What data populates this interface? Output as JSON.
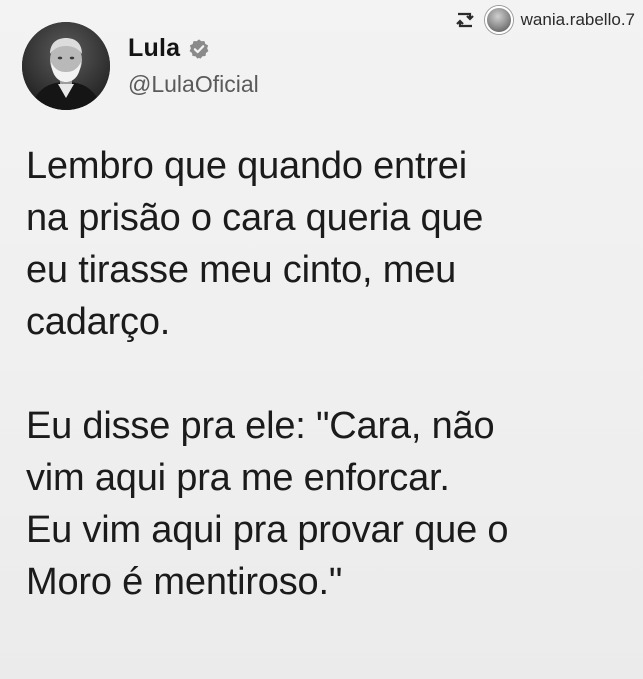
{
  "repost": {
    "icon": "repost-icon",
    "username": "wania.rabello.7"
  },
  "author": {
    "avatar": "avatar-photo",
    "name": "Lula",
    "handle": "@LulaOficial",
    "verified_icon": "verified-badge-icon"
  },
  "tweet": {
    "paragraphs": [
      "Lembro que quando entrei\nna prisão o cara queria que\neu tirasse meu cinto, meu\ncadarço.",
      "Eu disse pra ele: \"Cara, não\nvim aqui pra me enforcar.\nEu vim aqui pra provar que o\nMoro é mentiroso.\""
    ]
  }
}
